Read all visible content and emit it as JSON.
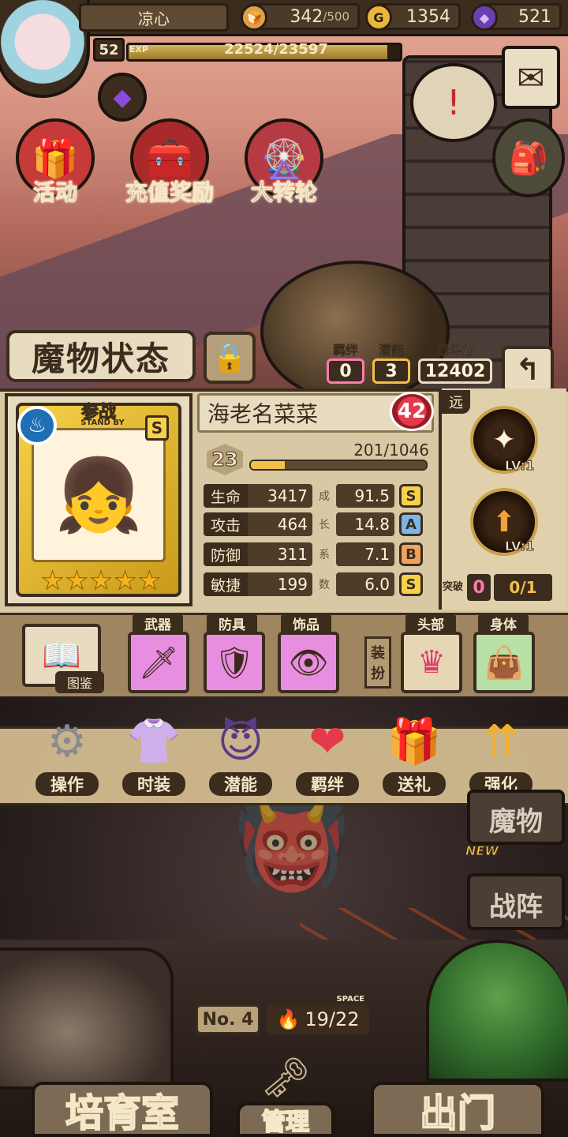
{
  "player": {
    "name": "凉心",
    "level": "52",
    "exp_label": "EXP",
    "exp_text": "22524/23597",
    "exp_progress": 0.954
  },
  "resources": {
    "stamina": "342",
    "stamina_max": "/500",
    "gold": "1354",
    "gold_icon": "G",
    "gems": "521"
  },
  "events": [
    {
      "label": "活动",
      "icon": "gift-icon"
    },
    {
      "label": "充值奖励",
      "icon": "treasure-chest-icon"
    },
    {
      "label": "大转轮",
      "icon": "wheel-icon"
    }
  ],
  "status": {
    "title": "魔物状态",
    "bond_label": "羁绊",
    "bond_value": "0",
    "potential_label": "潜能",
    "potential_value": "3",
    "power_label": "战斗力",
    "power_value": "12402"
  },
  "monster": {
    "standby_label": "参战",
    "standby_sub": "STAND BY",
    "rank": "S",
    "stars": 5,
    "name": "海老名菜菜",
    "affection": "42",
    "level": "23",
    "level_exp": "201/1046",
    "level_progress": 0.192,
    "growth_label_chars": [
      "成",
      "长",
      "系",
      "数"
    ],
    "stats": [
      {
        "name": "生命",
        "value": "3417",
        "growth": "91.5",
        "grade": "S"
      },
      {
        "name": "攻击",
        "value": "464",
        "growth": "14.8",
        "grade": "A"
      },
      {
        "name": "防御",
        "value": "311",
        "growth": "7.1",
        "grade": "B"
      },
      {
        "name": "敏捷",
        "value": "199",
        "growth": "6.0",
        "grade": "S"
      }
    ],
    "range": "远",
    "skills": [
      {
        "lv": "LV:1"
      },
      {
        "lv": "LV:1"
      }
    ],
    "breakthrough_label": "突破",
    "breakthrough_value": "0",
    "breakthrough_total": "0/1"
  },
  "equipment": {
    "book_label": "图鉴",
    "slots": [
      {
        "label": "武器"
      },
      {
        "label": "防具"
      },
      {
        "label": "饰品"
      }
    ],
    "outfit_label": "装扮",
    "outfit_slots": [
      {
        "label": "头部"
      },
      {
        "label": "身体"
      }
    ]
  },
  "actions": [
    {
      "label": "操作"
    },
    {
      "label": "时装"
    },
    {
      "label": "潜能"
    },
    {
      "label": "羁绊"
    },
    {
      "label": "送礼"
    },
    {
      "label": "强化"
    }
  ],
  "side": {
    "monster_label": "魔物",
    "new_label": "NEW",
    "formation_label": "战阵"
  },
  "bottom": {
    "no_label": "No. 4",
    "space_label": "SPACE",
    "space_value": "19/22",
    "nurture_label": "培育室",
    "manage_label": "管理",
    "exit_label": "出门"
  },
  "colors": {
    "grade_S": "#f6d14a",
    "grade_A": "#7fb4e8",
    "grade_B": "#f0a25a",
    "bond_border": "#ff7ab0",
    "potential_border": "#f2c04a",
    "power_border": "#e8dcc0"
  }
}
